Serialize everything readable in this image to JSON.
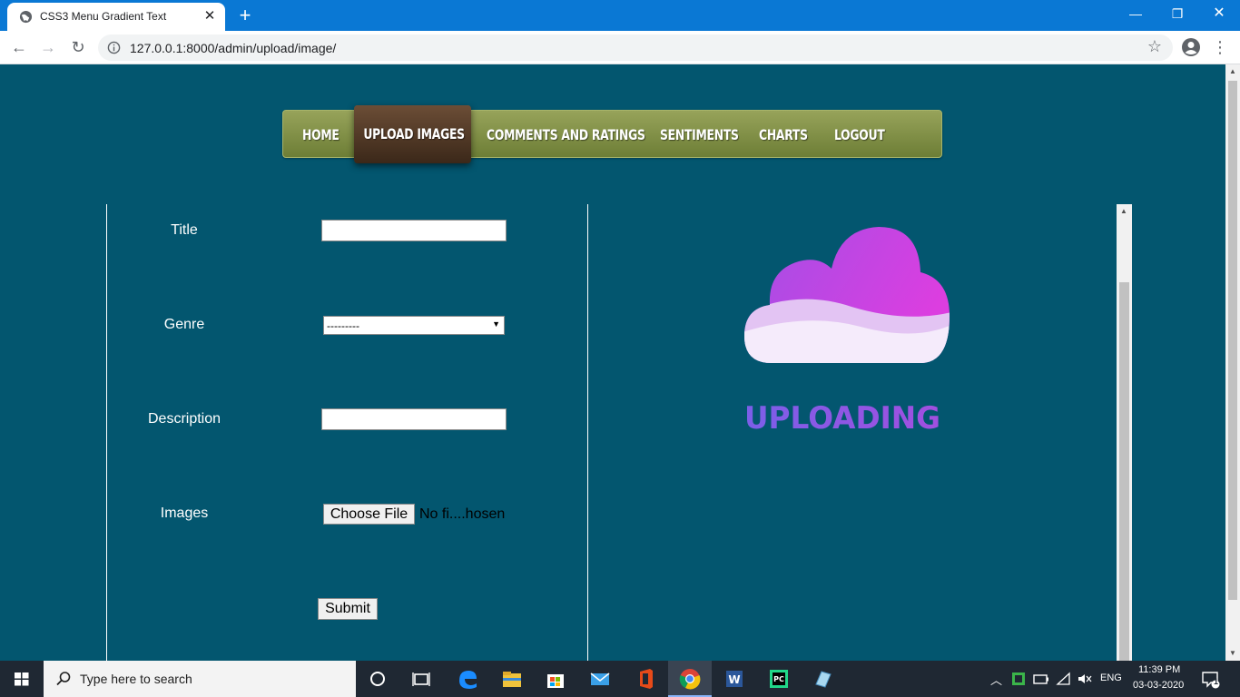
{
  "browser": {
    "tab_title": "CSS3 Menu Gradient Text",
    "url": "127.0.0.1:8000/admin/upload/image/"
  },
  "nav": {
    "items": [
      "HOME",
      "UPLOAD IMAGES",
      "COMMENTS AND RATINGS",
      "SENTIMENTS",
      "CHARTS",
      "LOGOUT"
    ],
    "active": "UPLOAD IMAGES"
  },
  "form": {
    "title_label": "Title",
    "title_value": "",
    "genre_label": "Genre",
    "genre_selected": "---------",
    "description_label": "Description",
    "description_value": "",
    "images_label": "Images",
    "choose_file_label": "Choose File",
    "file_status": "No fi....hosen",
    "submit_label": "Submit"
  },
  "illustration": {
    "caption": "UPLOADING",
    "colors": {
      "cloud_top": "#b84fe0",
      "cloud_bottom": "#f3e6fb",
      "text": "#8a5ae6"
    }
  },
  "taskbar": {
    "search_placeholder": "Type here to search",
    "language": "ENG",
    "time": "11:39 PM",
    "date": "03-03-2020",
    "notification_count": "1"
  },
  "colors": {
    "page_bg": "#03566f",
    "titlebar": "#0a78d4",
    "menu_green": "#7f8e44",
    "menu_active_brown": "#4f3725"
  }
}
